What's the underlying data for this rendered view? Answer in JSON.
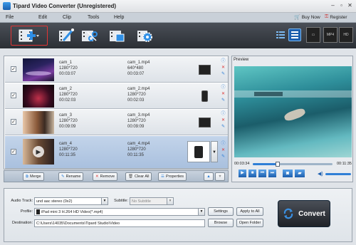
{
  "app": {
    "title": "Tipard Video Converter (Unregistered)"
  },
  "menu": {
    "items": [
      "File",
      "Edit",
      "Clip",
      "Tools",
      "Help"
    ],
    "buy_now": "Buy Now",
    "register": "Register"
  },
  "files": [
    {
      "name": "cam_1",
      "res": "1280*720",
      "dur": "00:03:07",
      "out_name": "cam_1.mp4",
      "out_res": "640*480",
      "out_dur": "00:03:07",
      "checked": true
    },
    {
      "name": "cam_2",
      "res": "1280*720",
      "dur": "00:02:03",
      "out_name": "cam_2.mp4",
      "out_res": "1280*720",
      "out_dur": "00:02:03",
      "checked": true
    },
    {
      "name": "cam_3",
      "res": "1280*720",
      "dur": "00:09:09",
      "out_name": "cam_3.mp4",
      "out_res": "1280*720",
      "out_dur": "00:09:09",
      "checked": true
    },
    {
      "name": "cam_4",
      "res": "1280*720",
      "dur": "00:11:35",
      "out_name": "cam_4.mp4",
      "out_res": "1280*720",
      "out_dur": "00:11:35",
      "checked": true
    }
  ],
  "list_buttons": {
    "merge": "Merge",
    "rename": "Rename",
    "remove": "Remove",
    "clear_all": "Clear All",
    "properties": "Properties"
  },
  "preview": {
    "label": "Preview",
    "current_time": "00:03:34",
    "total_time": "00:11:35",
    "progress": 0.31
  },
  "settings": {
    "audio_track_label": "Audio Track:",
    "audio_track_value": "und aac stereo (0x2)",
    "subtitle_label": "Subtitle:",
    "subtitle_value": "No Subtitle",
    "profile_label": "Profile:",
    "profile_value": "iPad mini 3 H.264 HD Video(*.mp4)",
    "destination_label": "Destination:",
    "destination_value": "C:\\Users\\14035\\Documents\\Tipard Studio\\Video",
    "settings_button": "Settings",
    "apply_all_button": "Apply to All",
    "browse_button": "Browse",
    "open_folder_button": "Open Folder",
    "convert_button": "Convert"
  },
  "colors": {
    "accent_red": "#e23434",
    "toolbar_dark": "#2b2f35",
    "selected_row": "#a9c0de",
    "convert_icon": "#3a8fe0"
  }
}
